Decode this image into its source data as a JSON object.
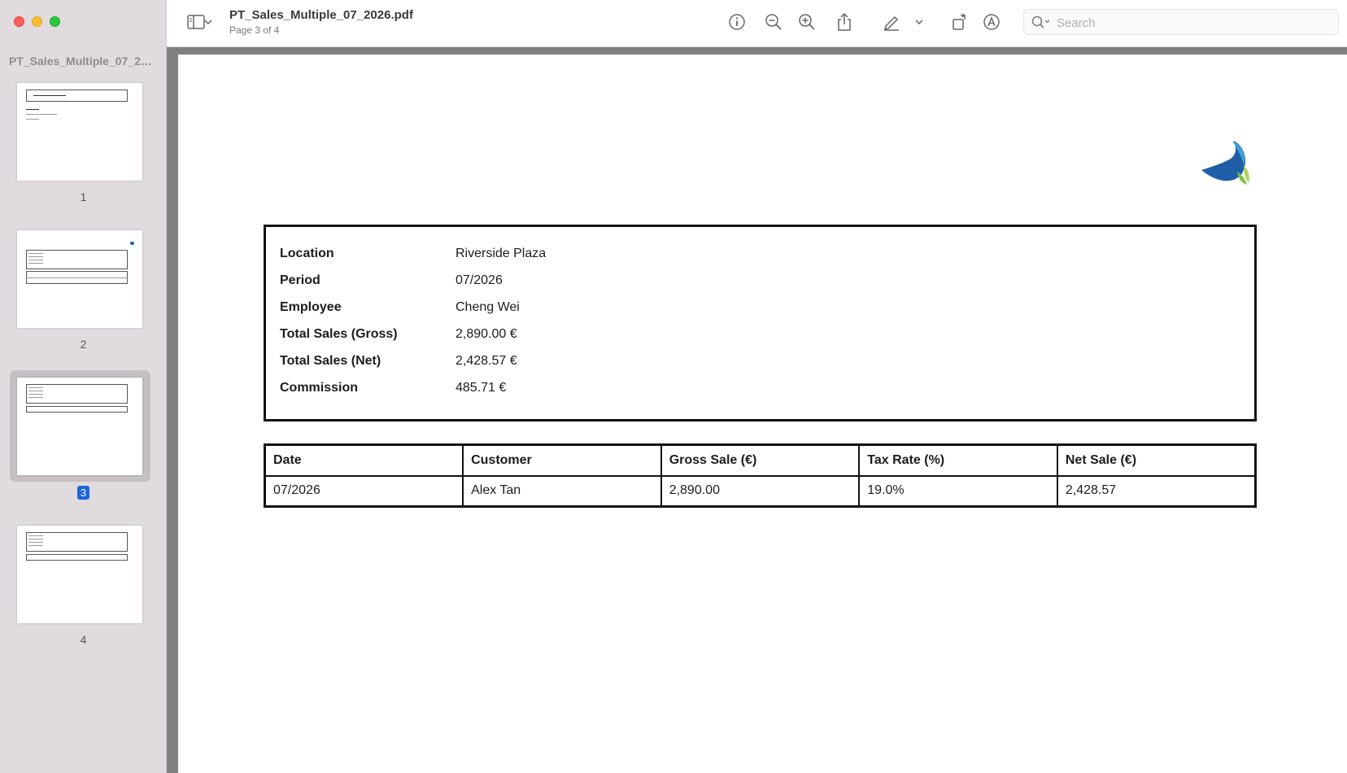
{
  "window": {
    "filename": "PT_Sales_Multiple_07_2026.pdf",
    "page_indicator": "Page 3 of 4"
  },
  "sidebar": {
    "title": "PT_Sales_Multiple_07_2026.pdf",
    "thumbnails": [
      {
        "page": "1",
        "selected": false
      },
      {
        "page": "2",
        "selected": false
      },
      {
        "page": "3",
        "selected": true
      },
      {
        "page": "4",
        "selected": false
      }
    ]
  },
  "toolbar": {
    "icons": [
      "sidebar-toggle-icon",
      "chevron-down-icon",
      "info-icon",
      "zoom-out-icon",
      "zoom-in-icon",
      "share-icon",
      "markup-pen-icon",
      "chevron-down-icon",
      "rotate-icon",
      "annotate-icon",
      "search-icon"
    ],
    "search_placeholder": "Search"
  },
  "document": {
    "info": [
      {
        "label": "Location",
        "value": "Riverside Plaza"
      },
      {
        "label": "Period",
        "value": "07/2026"
      },
      {
        "label": "Employee",
        "value": "Cheng Wei"
      },
      {
        "label": "Total Sales (Gross)",
        "value": "2,890.00 €"
      },
      {
        "label": "Total Sales (Net)",
        "value": "2,428.57 €"
      },
      {
        "label": "Commission",
        "value": "485.71 €"
      }
    ],
    "table": {
      "headers": [
        "Date",
        "Customer",
        "Gross Sale (€)",
        "Tax Rate (%)",
        "Net Sale (€)"
      ],
      "rows": [
        [
          "07/2026",
          "Alex Tan",
          "2,890.00",
          "19.0%",
          "2,428.57"
        ]
      ]
    }
  },
  "colors": {
    "sidebar_bg": "#e1dbe0",
    "selection_accent": "#1b64d8",
    "logo_blue": "#1f5fa8",
    "logo_green": "#7cc242"
  }
}
